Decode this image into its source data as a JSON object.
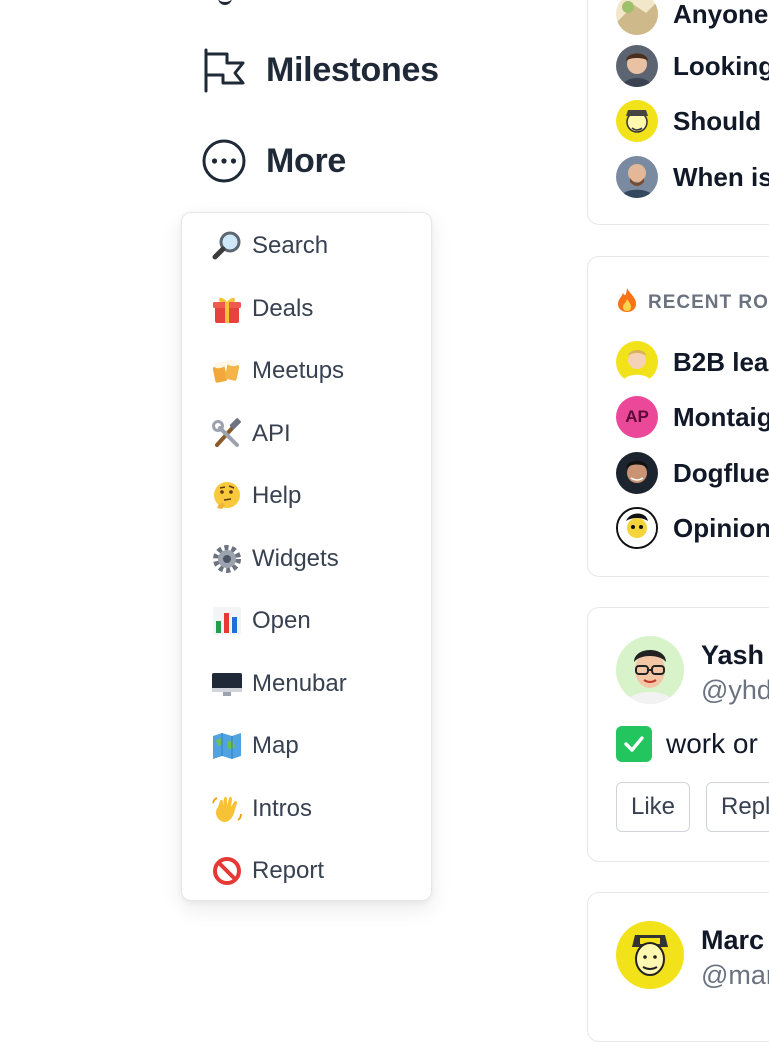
{
  "nav": {
    "milestones_label": "Milestones",
    "more_label": "More"
  },
  "menu": {
    "items": [
      {
        "label": "Search",
        "icon": "magnifier-icon"
      },
      {
        "label": "Deals",
        "icon": "gift-icon"
      },
      {
        "label": "Meetups",
        "icon": "beer-mugs-icon"
      },
      {
        "label": "API",
        "icon": "hammer-wrench-icon"
      },
      {
        "label": "Help",
        "icon": "thinking-face-icon"
      },
      {
        "label": "Widgets",
        "icon": "gear-icon"
      },
      {
        "label": "Open",
        "icon": "bar-chart-icon"
      },
      {
        "label": "Menubar",
        "icon": "desktop-icon"
      },
      {
        "label": "Map",
        "icon": "world-map-icon"
      },
      {
        "label": "Intros",
        "icon": "waving-hand-icon"
      },
      {
        "label": "Report",
        "icon": "no-entry-icon"
      }
    ]
  },
  "questions": {
    "items": [
      {
        "text": "Anyone"
      },
      {
        "text": "Looking"
      },
      {
        "text": "Should"
      },
      {
        "text": "When is"
      }
    ]
  },
  "recent": {
    "title": "RECENT RO",
    "items": [
      {
        "text": "B2B lea",
        "avatar": "photo"
      },
      {
        "text": "Montaig",
        "avatar": "initials",
        "initials": "AP"
      },
      {
        "text": "Dogflue",
        "avatar": "photo"
      },
      {
        "text": "Opinion",
        "avatar": "photo"
      }
    ]
  },
  "post1": {
    "name": "Yash",
    "handle": "@yhd",
    "task": "work or",
    "like_label": "Like",
    "reply_label": "Reply"
  },
  "post2": {
    "name": "Marc",
    "handle": "@mar"
  },
  "colors": {
    "text": "#1f2937",
    "muted": "#6b7280",
    "border": "#e5e7eb",
    "check_green": "#22c55e",
    "initials_pink": "#ec4899"
  }
}
